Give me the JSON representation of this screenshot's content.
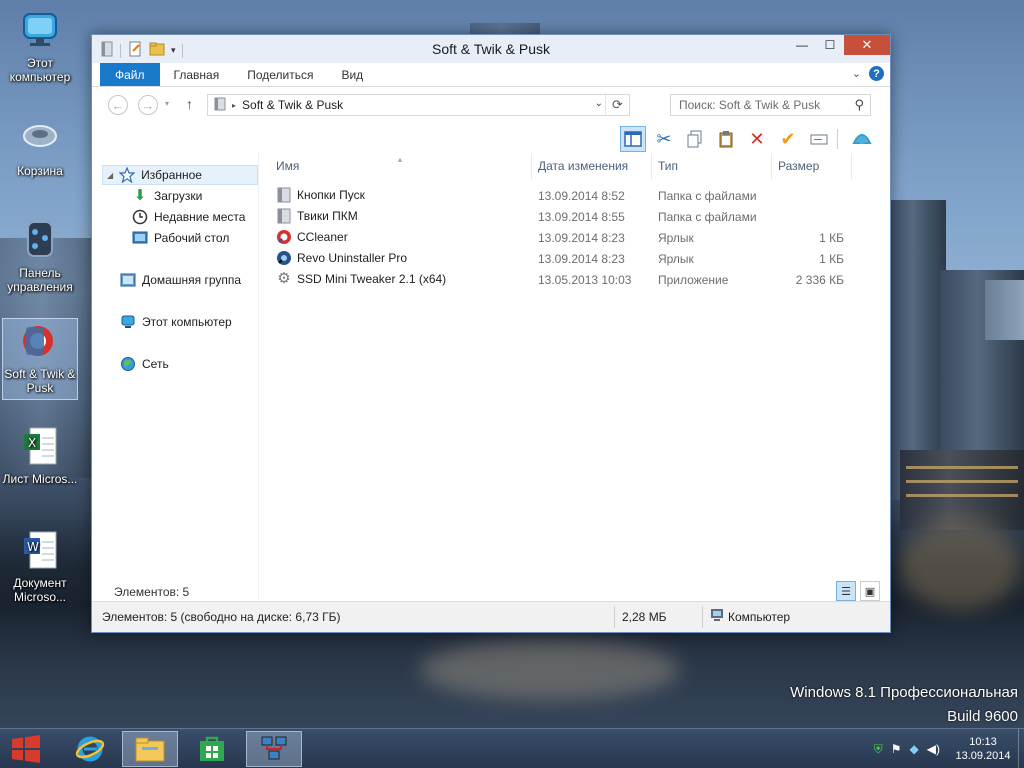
{
  "desktop": {
    "icons": [
      {
        "label": "Этот компьютер"
      },
      {
        "label": "Корзина"
      },
      {
        "label": "Панель управления"
      },
      {
        "label": "Soft & Twik & Pusk"
      },
      {
        "label": "Лист Micros..."
      },
      {
        "label": "Документ Microso..."
      }
    ],
    "watermark": {
      "line1": "Windows 8.1 Профессиональная",
      "line2": "Build 9600"
    }
  },
  "window": {
    "title": "Soft & Twik & Pusk",
    "controls": {
      "minimize": "—",
      "maximize": "☐",
      "close": "✕"
    }
  },
  "ribbon": {
    "tabs": [
      {
        "label": "Файл"
      },
      {
        "label": "Главная"
      },
      {
        "label": "Поделиться"
      },
      {
        "label": "Вид"
      }
    ]
  },
  "address": {
    "path": "Soft & Twik & Pusk",
    "search_placeholder": "Поиск: Soft & Twik & Pusk"
  },
  "nav": {
    "favorites": "Избранное",
    "downloads": "Загрузки",
    "recent": "Недавние места",
    "desktop": "Рабочий стол",
    "homegroup": "Домашняя группа",
    "computer": "Этот компьютер",
    "network": "Сеть"
  },
  "columns": {
    "name": "Имя",
    "date": "Дата изменения",
    "type": "Тип",
    "size": "Размер"
  },
  "files": [
    {
      "name": "Кнопки Пуск",
      "date": "13.09.2014 8:52",
      "type": "Папка с файлами",
      "size": "",
      "icon": "folder-icon"
    },
    {
      "name": "Твики ПКМ",
      "date": "13.09.2014 8:55",
      "type": "Папка с файлами",
      "size": "",
      "icon": "folder-icon"
    },
    {
      "name": "CCleaner",
      "date": "13.09.2014 8:23",
      "type": "Ярлык",
      "size": "1 КБ",
      "icon": "ccleaner-icon"
    },
    {
      "name": "Revo Uninstaller Pro",
      "date": "13.09.2014 8:23",
      "type": "Ярлык",
      "size": "1 КБ",
      "icon": "revo-icon"
    },
    {
      "name": "SSD Mini Tweaker 2.1 (x64)",
      "date": "13.05.2013 10:03",
      "type": "Приложение",
      "size": "2 336 КБ",
      "icon": "gear-app-icon"
    }
  ],
  "content_status": "Элементов: 5",
  "statusbar": {
    "items": "Элементов: 5 (свободно на диске: 6,73 ГБ)",
    "size": "2,28 МБ",
    "location": "Компьютер"
  },
  "taskbar": {
    "time": "10:13",
    "date": "13.09.2014"
  },
  "colors": {
    "accent": "#1979ca",
    "close_button": "#c7503b"
  }
}
